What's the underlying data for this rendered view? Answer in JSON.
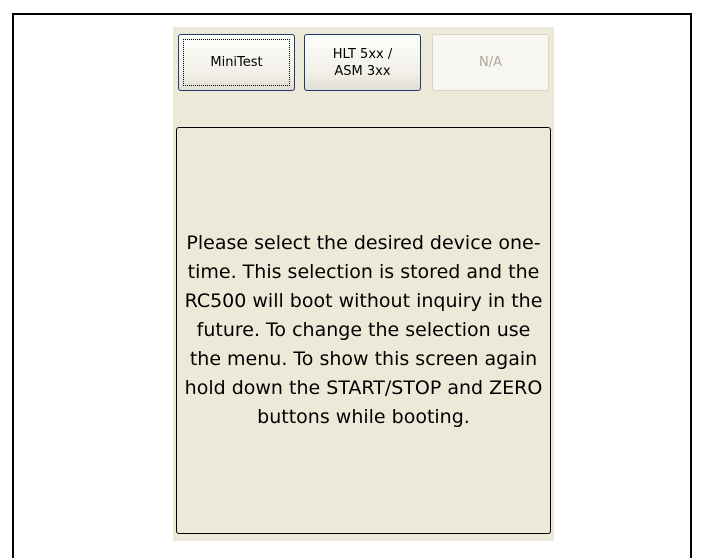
{
  "device_select": {
    "buttons": [
      {
        "label": "MiniTest",
        "state": "focused"
      },
      {
        "label": "HLT 5xx /\nASM 3xx",
        "state": "enabled"
      },
      {
        "label": "N/A",
        "state": "disabled"
      }
    ],
    "message": "Please select the desired device one-time. This selection is stored and the RC500 will boot without inquiry in the future. To change the selection use the menu. To show this screen again hold down the START/STOP and ZERO buttons while booting."
  },
  "colors": {
    "panel_background": "#ece9d8",
    "button_border": "#1f3b6e",
    "disabled_text": "#aca899"
  }
}
